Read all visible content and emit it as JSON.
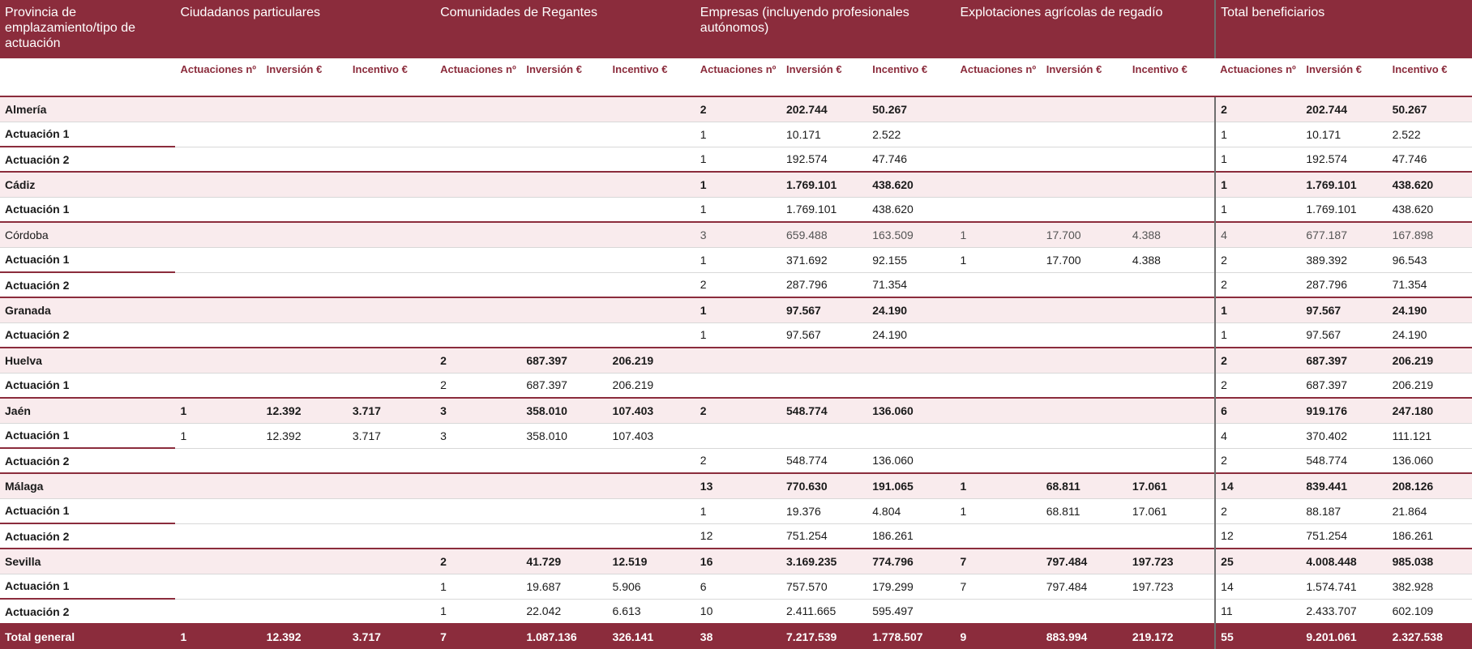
{
  "groups": [
    "Provincia de emplazamiento/tipo de actuación",
    "Ciudadanos particulares",
    "Comunidades de Regantes",
    "Empresas (incluyendo profesionales autónomos)",
    "Explotaciones agrícolas de regadío",
    "Total beneficiarios"
  ],
  "subheaders": [
    "Actuaciones nº",
    "Inversión €",
    "Incentivo €"
  ],
  "rows": [
    {
      "type": "prov",
      "style": "bold",
      "label": "Almería",
      "c": [
        "",
        "",
        "",
        "",
        "",
        "",
        "2",
        "202.744",
        "50.267",
        "",
        "",
        "",
        "2",
        "202.744",
        "50.267"
      ]
    },
    {
      "type": "act",
      "label": "Actuación 1",
      "c": [
        "",
        "",
        "",
        "",
        "",
        "",
        "1",
        "10.171",
        "2.522",
        "",
        "",
        "",
        "1",
        "10.171",
        "2.522"
      ]
    },
    {
      "type": "act",
      "label": "Actuación 2",
      "c": [
        "",
        "",
        "",
        "",
        "",
        "",
        "1",
        "192.574",
        "47.746",
        "",
        "",
        "",
        "1",
        "192.574",
        "47.746"
      ]
    },
    {
      "type": "prov",
      "style": "bold",
      "label": "Cádiz",
      "c": [
        "",
        "",
        "",
        "",
        "",
        "",
        "1",
        "1.769.101",
        "438.620",
        "",
        "",
        "",
        "1",
        "1.769.101",
        "438.620"
      ]
    },
    {
      "type": "act",
      "label": "Actuación 1",
      "c": [
        "",
        "",
        "",
        "",
        "",
        "",
        "1",
        "1.769.101",
        "438.620",
        "",
        "",
        "",
        "1",
        "1.769.101",
        "438.620"
      ]
    },
    {
      "type": "prov",
      "style": "light",
      "label": "Córdoba",
      "c": [
        "",
        "",
        "",
        "",
        "",
        "",
        "3",
        "659.488",
        "163.509",
        "1",
        "17.700",
        "4.388",
        "4",
        "677.187",
        "167.898"
      ]
    },
    {
      "type": "act",
      "label": "Actuación 1",
      "c": [
        "",
        "",
        "",
        "",
        "",
        "",
        "1",
        "371.692",
        "92.155",
        "1",
        "17.700",
        "4.388",
        "2",
        "389.392",
        "96.543"
      ]
    },
    {
      "type": "act",
      "label": "Actuación 2",
      "c": [
        "",
        "",
        "",
        "",
        "",
        "",
        "2",
        "287.796",
        "71.354",
        "",
        "",
        "",
        "2",
        "287.796",
        "71.354"
      ]
    },
    {
      "type": "prov",
      "style": "bold",
      "label": "Granada",
      "c": [
        "",
        "",
        "",
        "",
        "",
        "",
        "1",
        "97.567",
        "24.190",
        "",
        "",
        "",
        "1",
        "97.567",
        "24.190"
      ]
    },
    {
      "type": "act",
      "label": "Actuación 2",
      "c": [
        "",
        "",
        "",
        "",
        "",
        "",
        "1",
        "97.567",
        "24.190",
        "",
        "",
        "",
        "1",
        "97.567",
        "24.190"
      ]
    },
    {
      "type": "prov",
      "style": "bold",
      "label": "Huelva",
      "c": [
        "",
        "",
        "",
        "2",
        "687.397",
        "206.219",
        "",
        "",
        "",
        "",
        "",
        "",
        "2",
        "687.397",
        "206.219"
      ]
    },
    {
      "type": "act",
      "label": "Actuación 1",
      "c": [
        "",
        "",
        "",
        "2",
        "687.397",
        "206.219",
        "",
        "",
        "",
        "",
        "",
        "",
        "2",
        "687.397",
        "206.219"
      ]
    },
    {
      "type": "prov",
      "style": "bold",
      "label": "Jaén",
      "c": [
        "1",
        "12.392",
        "3.717",
        "3",
        "358.010",
        "107.403",
        "2",
        "548.774",
        "136.060",
        "",
        "",
        "",
        "6",
        "919.176",
        "247.180"
      ]
    },
    {
      "type": "act",
      "label": "Actuación 1",
      "c": [
        "1",
        "12.392",
        "3.717",
        "3",
        "358.010",
        "107.403",
        "",
        "",
        "",
        "",
        "",
        "",
        "4",
        "370.402",
        "111.121"
      ]
    },
    {
      "type": "act",
      "label": "Actuación 2",
      "c": [
        "",
        "",
        "",
        "",
        "",
        "",
        "2",
        "548.774",
        "136.060",
        "",
        "",
        "",
        "2",
        "548.774",
        "136.060"
      ]
    },
    {
      "type": "prov",
      "style": "bold",
      "label": "Málaga",
      "c": [
        "",
        "",
        "",
        "",
        "",
        "",
        "13",
        "770.630",
        "191.065",
        "1",
        "68.811",
        "17.061",
        "14",
        "839.441",
        "208.126"
      ]
    },
    {
      "type": "act",
      "label": "Actuación 1",
      "c": [
        "",
        "",
        "",
        "",
        "",
        "",
        "1",
        "19.376",
        "4.804",
        "1",
        "68.811",
        "17.061",
        "2",
        "88.187",
        "21.864"
      ]
    },
    {
      "type": "act",
      "label": "Actuación 2",
      "c": [
        "",
        "",
        "",
        "",
        "",
        "",
        "12",
        "751.254",
        "186.261",
        "",
        "",
        "",
        "12",
        "751.254",
        "186.261"
      ]
    },
    {
      "type": "prov",
      "style": "bold",
      "label": "Sevilla",
      "c": [
        "",
        "",
        "",
        "2",
        "41.729",
        "12.519",
        "16",
        "3.169.235",
        "774.796",
        "7",
        "797.484",
        "197.723",
        "25",
        "4.008.448",
        "985.038"
      ]
    },
    {
      "type": "act",
      "label": "Actuación 1",
      "c": [
        "",
        "",
        "",
        "1",
        "19.687",
        "5.906",
        "6",
        "757.570",
        "179.299",
        "7",
        "797.484",
        "197.723",
        "14",
        "1.574.741",
        "382.928"
      ]
    },
    {
      "type": "act",
      "label": "Actuación 2",
      "c": [
        "",
        "",
        "",
        "1",
        "22.042",
        "6.613",
        "10",
        "2.411.665",
        "595.497",
        "",
        "",
        "",
        "11",
        "2.433.707",
        "602.109"
      ]
    },
    {
      "type": "total",
      "label": "Total general",
      "c": [
        "1",
        "12.392",
        "3.717",
        "7",
        "1.087.136",
        "326.141",
        "38",
        "7.217.539",
        "1.778.507",
        "9",
        "883.994",
        "219.172",
        "55",
        "9.201.061",
        "2.327.538"
      ]
    }
  ]
}
